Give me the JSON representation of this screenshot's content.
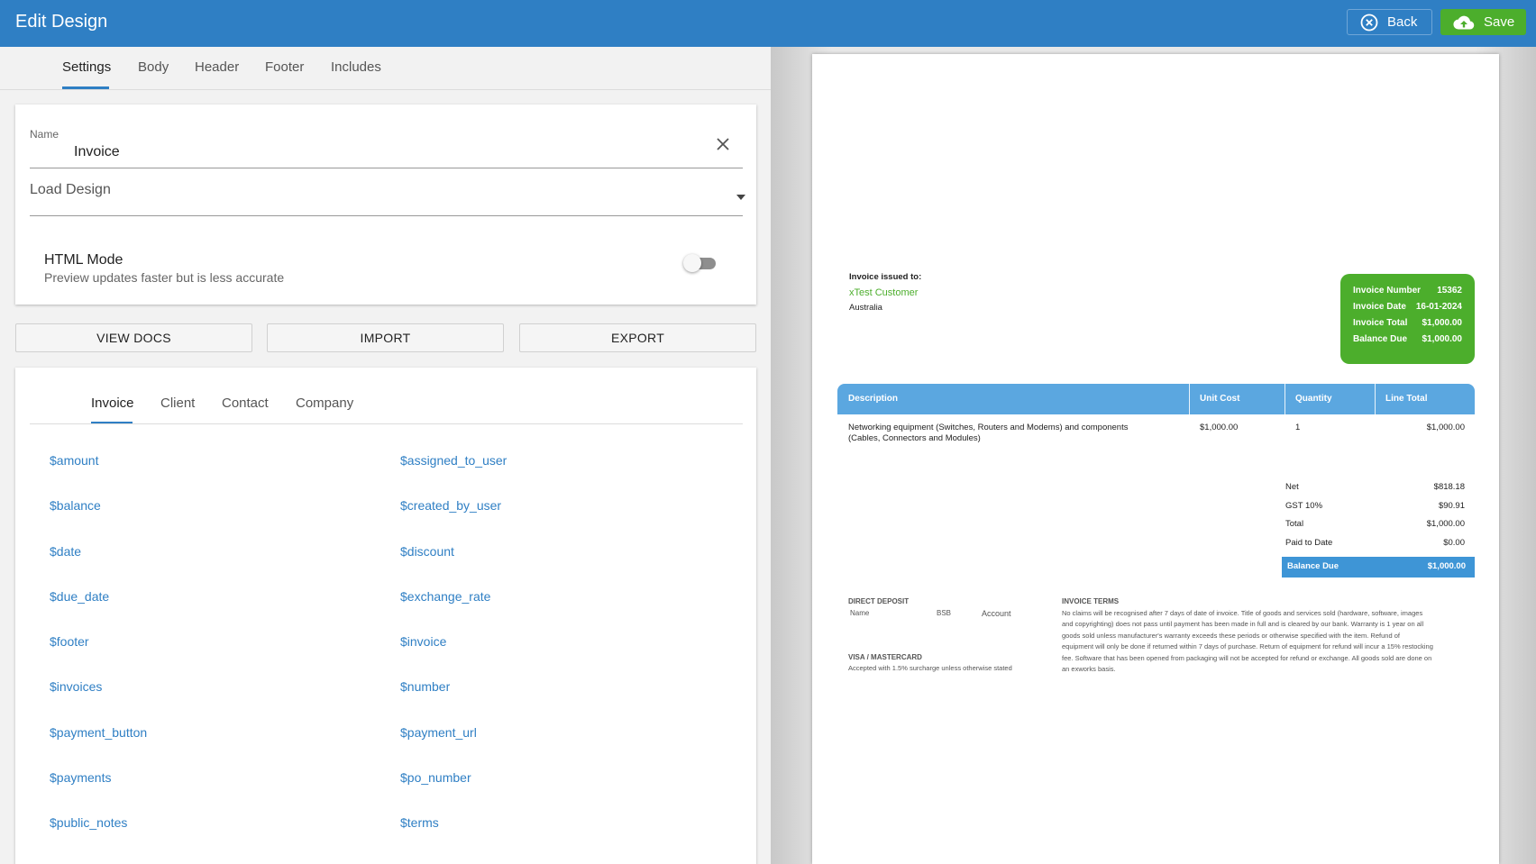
{
  "topbar": {
    "title": "Edit Design",
    "back_label": "Back",
    "save_label": "Save",
    "back_icon": "close-circle-icon",
    "save_icon": "cloud-upload-icon",
    "accent": "#2f7fc4",
    "save_color": "#4cae2c"
  },
  "tabs": [
    "Settings",
    "Body",
    "Header",
    "Footer",
    "Includes"
  ],
  "settings": {
    "name_label": "Name",
    "name_value": "Invoice",
    "load_design_label": "Load Design",
    "html_mode_title": "HTML Mode",
    "html_mode_sub": "Preview updates faster but is less accurate",
    "html_mode_on": false
  },
  "actions": [
    "VIEW DOCS",
    "IMPORT",
    "EXPORT"
  ],
  "variable_tabs": [
    "Invoice",
    "Client",
    "Contact",
    "Company"
  ],
  "variables_left": [
    "$amount",
    "$balance",
    "$date",
    "$due_date",
    "$footer",
    "$invoices",
    "$payment_button",
    "$payments",
    "$public_notes"
  ],
  "variables_right": [
    "$assigned_to_user",
    "$created_by_user",
    "$discount",
    "$exchange_rate",
    "$invoice",
    "$number",
    "$payment_url",
    "$po_number",
    "$terms"
  ],
  "preview": {
    "issued_to_label": "Invoice issued to:",
    "client_name": "xTest Customer",
    "client_country": "Australia",
    "info": [
      {
        "label": "Invoice Number",
        "value": "15362"
      },
      {
        "label": "Invoice Date",
        "value": "16-01-2024"
      },
      {
        "label": "Invoice Total",
        "value": "$1,000.00"
      },
      {
        "label": "Balance Due",
        "value": "$1,000.00"
      }
    ],
    "table_headers": [
      "Description",
      "Unit Cost",
      "Quantity",
      "Line Total"
    ],
    "item": {
      "description_line1": "Networking equipment (Switches, Routers and Modems) and components",
      "description_line2": "(Cables, Connectors and Modules)",
      "unit_cost": "$1,000.00",
      "quantity": "1",
      "line_total": "$1,000.00"
    },
    "totals": [
      {
        "label": "Net",
        "value": "$818.18"
      },
      {
        "label": "GST 10%",
        "value": "$90.91"
      },
      {
        "label": "Total",
        "value": "$1,000.00"
      },
      {
        "label": "Paid to Date",
        "value": "$0.00"
      }
    ],
    "balance_due_label": "Balance Due",
    "balance_due_value": "$1,000.00",
    "direct_deposit_label": "DIRECT DEPOSIT",
    "dd_name": "Name",
    "dd_bsb": "BSB",
    "dd_account": "Account",
    "visa_label": "VISA / MASTERCARD",
    "visa_text": "Accepted with 1.5% surcharge unless otherwise stated",
    "terms_label": "INVOICE TERMS",
    "terms_lines": [
      "No claims will be recognised after 7 days of date of invoice. Title of goods and services sold (hardware, software, images",
      "and copyrighting) does not pass until payment has been made in full and is cleared by our bank. Warranty is 1 year on all",
      "goods sold unless manufacturer's warranty exceeds these periods or otherwise specified with the item. Refund of",
      "equipment will only be done if returned within 7 days of purchase. Return of equipment for refund will incur a 15% restocking",
      "fee. Software that has been opened from packaging will not be accepted for refund or exchange. All goods sold are done on",
      "an exworks basis."
    ]
  }
}
